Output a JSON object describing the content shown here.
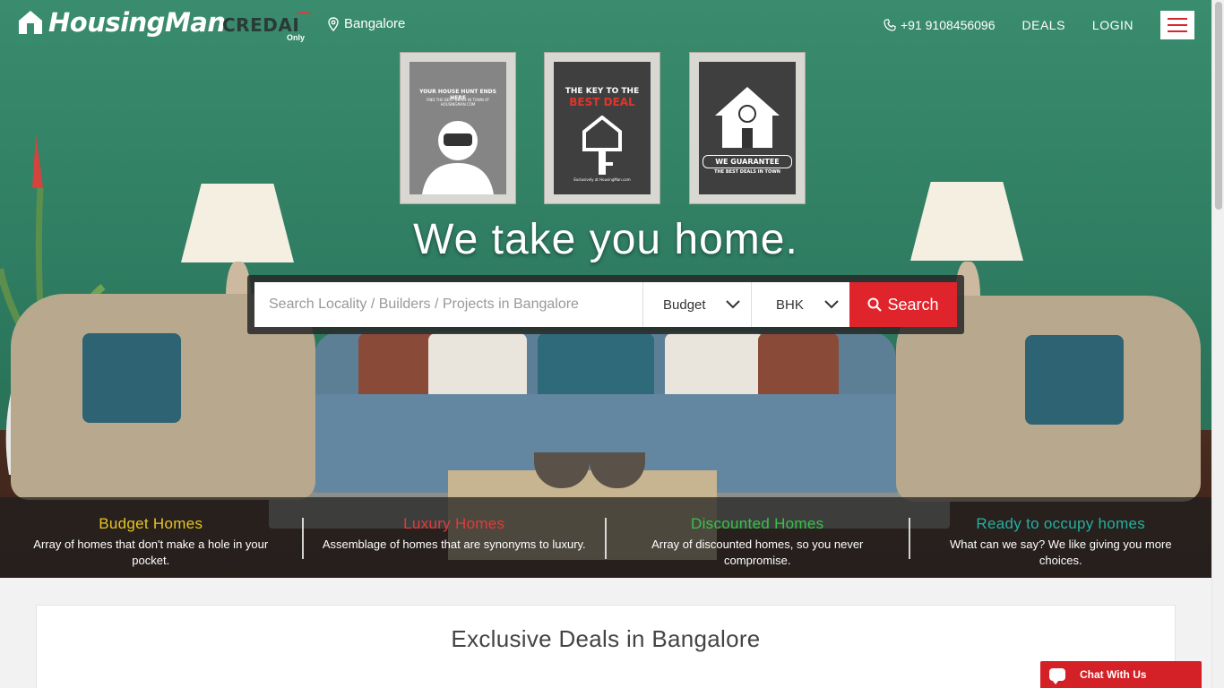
{
  "brand": {
    "name": "HousingMan",
    "partner": "CREDAI",
    "partner_tag": "Only"
  },
  "header": {
    "location": "Bangalore",
    "phone": "+91 9108456096",
    "deals_label": "DEALS",
    "login_label": "LOGIN"
  },
  "posters": {
    "p1_line1": "YOUR HOUSE HUNT ENDS HERE",
    "p1_line2": "FIND THE BEST DEALS IN TOWN AT HOUSINGMAN.COM",
    "p2_line1": "THE KEY TO THE",
    "p2_line2": "BEST DEAL",
    "p2_line3": "Exclusively at HousingMan.com",
    "p3_line1": "WE GUARANTEE",
    "p3_line2": "THE BEST DEALS IN TOWN"
  },
  "hero": {
    "headline": "We take you home."
  },
  "search": {
    "placeholder": "Search Locality / Builders / Projects in Bangalore",
    "budget_label": "Budget",
    "bhk_label": "BHK",
    "button_label": "Search"
  },
  "categories": [
    {
      "title": "Budget Homes",
      "desc": "Array of homes that don't make a hole in your pocket.",
      "color": "#e6c524"
    },
    {
      "title": "Luxury Homes",
      "desc": "Assemblage of homes that are synonyms to luxury.",
      "color": "#e23a3a"
    },
    {
      "title": "Discounted Homes",
      "desc": "Array of discounted homes, so you never compromise.",
      "color": "#36c24a"
    },
    {
      "title": "Ready to occupy homes",
      "desc": "What can we say? We like giving you more choices.",
      "color": "#25b0a0"
    }
  ],
  "deals": {
    "title": "Exclusive Deals in Bangalore"
  },
  "chat": {
    "label": "Chat With Us"
  },
  "colors": {
    "accent": "#e0242c",
    "hero_green": "#2f7d62"
  }
}
